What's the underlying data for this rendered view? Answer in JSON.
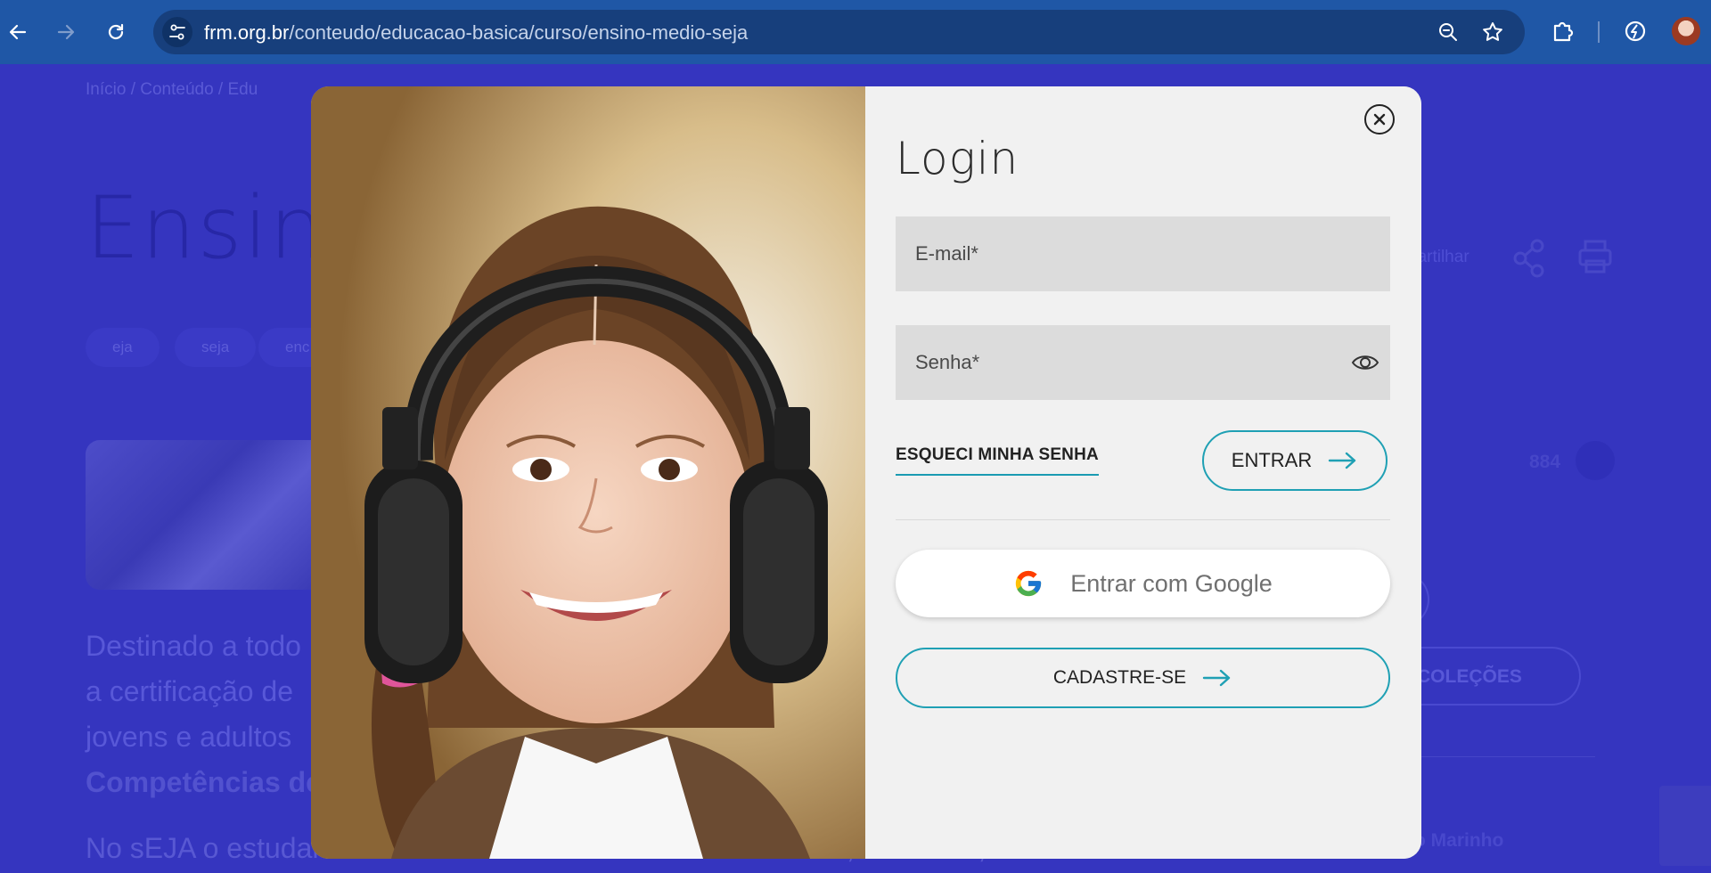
{
  "browser": {
    "url_host": "frm.org.br",
    "url_path": "/conteudo/educacao-basica/curso/ensino-medio-seja",
    "colors": {
      "chrome": "#1f57a6",
      "omnibox": "#173f7c"
    }
  },
  "page": {
    "breadcrumb": "Início   /   Conteúdo   /   Edu",
    "title": "Ensin",
    "tags": [
      "eja",
      "seja",
      "enc"
    ],
    "share_label": "partilhar",
    "like_count": "884",
    "description_lines": [
      "Destinado a todo",
      "a certificação de",
      "jovens e adultos"
    ],
    "description_bold": "Competências de",
    "description_line2": "No sEJA o estudante encontra uma variedade de conteúdos, materiais,",
    "collections_label": "COLEÇÕES",
    "author_label": "to Marinho"
  },
  "modal": {
    "title": "Login",
    "email_placeholder": "E-mail*",
    "password_placeholder": "Senha*",
    "forgot_label": "ESQUECI MINHA SENHA",
    "submit_label": "ENTRAR",
    "google_label": "Entrar com Google",
    "signup_label": "CADASTRE-SE",
    "colors": {
      "accent": "#1fa0b4",
      "field_bg": "#dcdcdc",
      "panel_bg": "#f1f1f1"
    }
  },
  "icons": {
    "back": "arrow-left-icon",
    "forward": "arrow-right-icon",
    "reload": "reload-icon",
    "site_info": "tune-icon",
    "zoom": "zoom-out-icon",
    "bookmark": "star-icon",
    "extensions": "puzzle-icon",
    "performance": "leaf-icon",
    "profile": "avatar",
    "close": "close-icon",
    "eye": "eye-icon",
    "google": "google-logo-icon",
    "arrow": "arrow-right-icon"
  }
}
